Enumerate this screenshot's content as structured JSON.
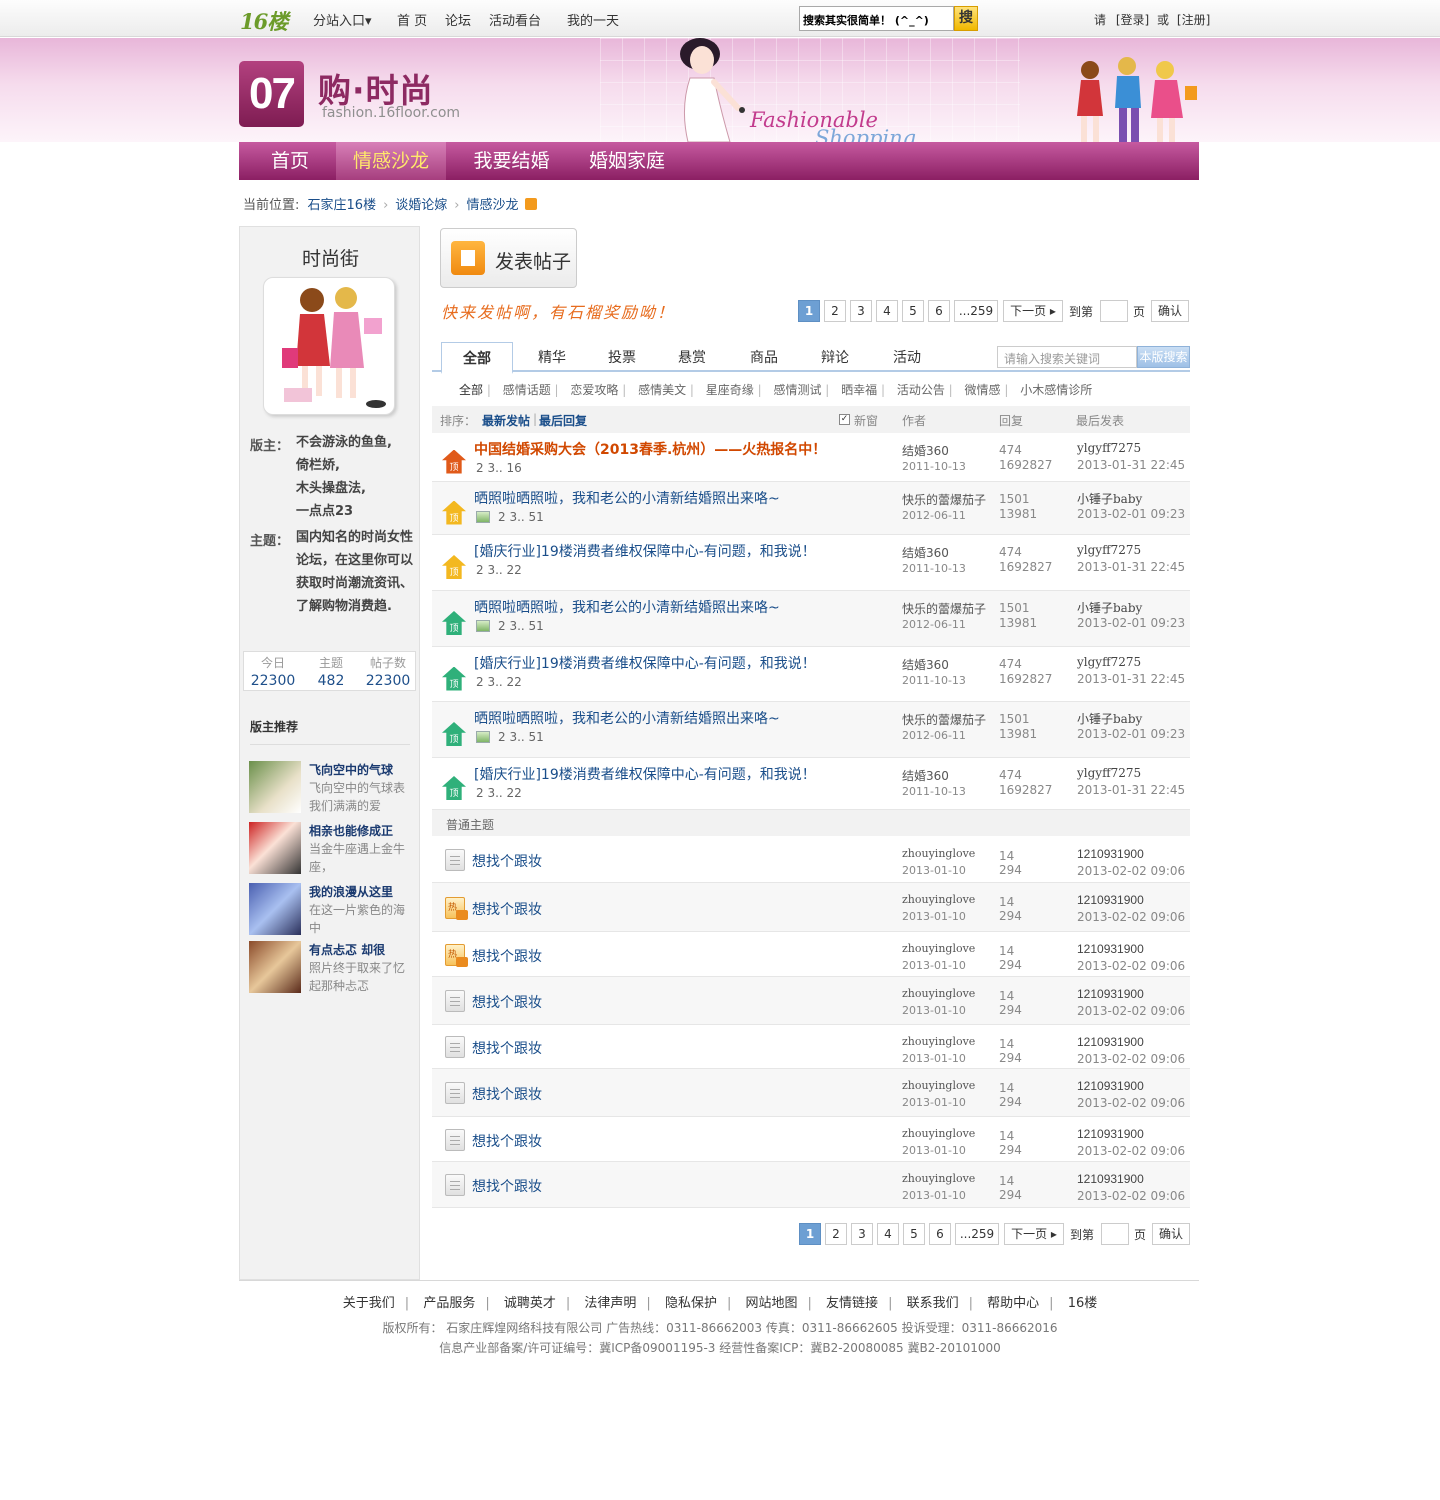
{
  "topbar": {
    "logo": "16楼",
    "nav": [
      "分站入口▾",
      "首 页",
      "论坛",
      "活动看台",
      "我的一天"
    ],
    "search_value": "搜索其实很简单！ (^_^)",
    "search_button": "搜",
    "login": {
      "prefix": "请",
      "login": "[登录]",
      "or": "或",
      "register": "[注册]"
    }
  },
  "banner": {
    "logo_number": "07",
    "title": "购·时尚",
    "domain": "fashion.16floor.com",
    "tagline1": "Fashionable",
    "tagline2": "Shopping"
  },
  "mainnav": [
    "首页",
    "情感沙龙",
    "我要结婚",
    "婚姻家庭"
  ],
  "breadcrumb": {
    "label": "当前位置:",
    "items": [
      "石家庄16楼",
      "谈婚论嫁",
      "情感沙龙"
    ]
  },
  "sidebar": {
    "title": "时尚街",
    "moderator_label": "版主：",
    "moderators": [
      "不会游泳的鱼鱼,",
      "倚栏娇,",
      "木头操盘法,",
      "一点点23"
    ],
    "topic_label": "主题：",
    "topic": "国内知名的时尚女性论坛，在这里你可以获取时尚潮流资讯、了解购物消费趋.",
    "stats": [
      {
        "key": "今日",
        "value": "22300"
      },
      {
        "key": "主题",
        "value": "482"
      },
      {
        "key": "帖子数",
        "value": "22300"
      }
    ],
    "rec_title": "版主推荐",
    "recommendations": [
      {
        "title": "飞向空中的气球",
        "desc": "飞向空中的气球表我们满满的爱"
      },
      {
        "title": "相亲也能修成正",
        "desc": "当金牛座遇上金牛座，"
      },
      {
        "title": "我的浪漫从这里",
        "desc": "在这一片紫色的海中"
      },
      {
        "title": "有点忐忑 却很",
        "desc": "照片终于取来了忆起那种忐忑"
      }
    ]
  },
  "post_button": "发表帖子",
  "slogan": "快来发帖啊，有石榴奖励呦！",
  "pager": {
    "pages": [
      "1",
      "2",
      "3",
      "4",
      "5",
      "6",
      "...259"
    ],
    "next": "下一页 ▸",
    "goto": "到第",
    "page_unit": "页",
    "confirm": "确认"
  },
  "tabs": [
    "全部",
    "精华",
    "投票",
    "悬赏",
    "商品",
    "辩论",
    "活动"
  ],
  "board_search": {
    "placeholder": "请输入搜索关键词",
    "button": "本版搜索"
  },
  "subcategories": [
    "全部",
    "感情话题",
    "恋爱攻略",
    "感情美文",
    "星座奇缘",
    "感情测试",
    "晒幸福",
    "活动公告",
    "微情感",
    "小木感情诊所"
  ],
  "table_header": {
    "sort_label": "排序：",
    "sort_new": "最新发帖",
    "sort_reply": "最后回复",
    "new_window": "新窗",
    "author": "作者",
    "replies": "回复",
    "last": "最后发表"
  },
  "sticky_posts": [
    {
      "icon": "red",
      "title": "中国结婚采购大会（2013春季.杭州）——火热报名中！",
      "hot": true,
      "pages": "2 3.. 16",
      "image": false,
      "author": "结婚360",
      "date": "2011-10-13",
      "replies": "474",
      "views": "1692827",
      "last_user": "ylgyff7275",
      "last_time": "2013-01-31 22:45"
    },
    {
      "icon": "yellow",
      "title": "晒照啦晒照啦，我和老公的小清新结婚照出来咯~",
      "hot": false,
      "pages": "2 3.. 51",
      "image": true,
      "author": "快乐的蕾爆茄子",
      "date": "2012-06-11",
      "replies": "1501",
      "views": "13981",
      "last_user": "小锤子baby",
      "last_time": "2013-02-01 09:23"
    },
    {
      "icon": "yellow",
      "title": "[婚庆行业]19楼消费者维权保障中心-有问题，和我说！",
      "hot": false,
      "pages": "2 3.. 22",
      "image": false,
      "author": "结婚360",
      "date": "2011-10-13",
      "replies": "474",
      "views": "1692827",
      "last_user": "ylgyff7275",
      "last_time": "2013-01-31 22:45"
    },
    {
      "icon": "green",
      "title": "晒照啦晒照啦，我和老公的小清新结婚照出来咯~",
      "hot": false,
      "pages": "2 3.. 51",
      "image": true,
      "author": "快乐的蕾爆茄子",
      "date": "2012-06-11",
      "replies": "1501",
      "views": "13981",
      "last_user": "小锤子baby",
      "last_time": "2013-02-01 09:23"
    },
    {
      "icon": "green",
      "title": "[婚庆行业]19楼消费者维权保障中心-有问题，和我说！",
      "hot": false,
      "pages": "2 3.. 22",
      "image": false,
      "author": "结婚360",
      "date": "2011-10-13",
      "replies": "474",
      "views": "1692827",
      "last_user": "ylgyff7275",
      "last_time": "2013-01-31 22:45"
    },
    {
      "icon": "green",
      "title": "晒照啦晒照啦，我和老公的小清新结婚照出来咯~",
      "hot": false,
      "pages": "2 3.. 51",
      "image": true,
      "author": "快乐的蕾爆茄子",
      "date": "2012-06-11",
      "replies": "1501",
      "views": "13981",
      "last_user": "小锤子baby",
      "last_time": "2013-02-01 09:23"
    },
    {
      "icon": "green",
      "title": "[婚庆行业]19楼消费者维权保障中心-有问题，和我说！",
      "hot": false,
      "pages": "2 3.. 22",
      "image": false,
      "author": "结婚360",
      "date": "2011-10-13",
      "replies": "474",
      "views": "1692827",
      "last_user": "ylgyff7275",
      "last_time": "2013-01-31 22:45"
    }
  ],
  "normal_header": "普通主题",
  "normal_posts": [
    {
      "icon": "normal",
      "title": "想找个跟妆",
      "author": "zhouyinglove",
      "date": "2013-01-10",
      "replies": "14",
      "views": "294",
      "last_user": "1210931900",
      "last_time": "2013-02-02 09:06"
    },
    {
      "icon": "hot",
      "title": "想找个跟妆",
      "author": "zhouyinglove",
      "date": "2013-01-10",
      "replies": "14",
      "views": "294",
      "last_user": "1210931900",
      "last_time": "2013-02-02 09:06"
    },
    {
      "icon": "hot",
      "title": "想找个跟妆",
      "author": "zhouyinglove",
      "date": "2013-01-10",
      "replies": "14",
      "views": "294",
      "last_user": "1210931900",
      "last_time": "2013-02-02 09:06"
    },
    {
      "icon": "normal",
      "title": "想找个跟妆",
      "author": "zhouyinglove",
      "date": "2013-01-10",
      "replies": "14",
      "views": "294",
      "last_user": "1210931900",
      "last_time": "2013-02-02 09:06"
    },
    {
      "icon": "normal",
      "title": "想找个跟妆",
      "author": "zhouyinglove",
      "date": "2013-01-10",
      "replies": "14",
      "views": "294",
      "last_user": "1210931900",
      "last_time": "2013-02-02 09:06"
    },
    {
      "icon": "normal",
      "title": "想找个跟妆",
      "author": "zhouyinglove",
      "date": "2013-01-10",
      "replies": "14",
      "views": "294",
      "last_user": "1210931900",
      "last_time": "2013-02-02 09:06"
    },
    {
      "icon": "normal",
      "title": "想找个跟妆",
      "author": "zhouyinglove",
      "date": "2013-01-10",
      "replies": "14",
      "views": "294",
      "last_user": "1210931900",
      "last_time": "2013-02-02 09:06"
    },
    {
      "icon": "normal",
      "title": "想找个跟妆",
      "author": "zhouyinglove",
      "date": "2013-01-10",
      "replies": "14",
      "views": "294",
      "last_user": "1210931900",
      "last_time": "2013-02-02 09:06"
    }
  ],
  "footer": {
    "links": [
      "关于我们",
      "产品服务",
      "诚聘英才",
      "法律声明",
      "隐私保护",
      "网站地图",
      "友情链接",
      "联系我们",
      "帮助中心",
      "16楼"
    ],
    "copyright": "版权所有： 石家庄辉煌网络科技有限公司    广告热线：0311-86662003  传真：0311-86662605    投诉受理：0311-86662016",
    "icp": "信息产业部备案/许可证编号：冀ICP备09001195-3    经营性备案ICP：冀B2-20080085    冀B2-20101000"
  },
  "colors": {
    "brand_purple": "#8d2a62",
    "link_blue": "#1a4e8a",
    "hot_orange": "#d14800",
    "icon_red": "#e05a1a",
    "icon_yellow": "#f3b820",
    "icon_green": "#2fb07a"
  }
}
